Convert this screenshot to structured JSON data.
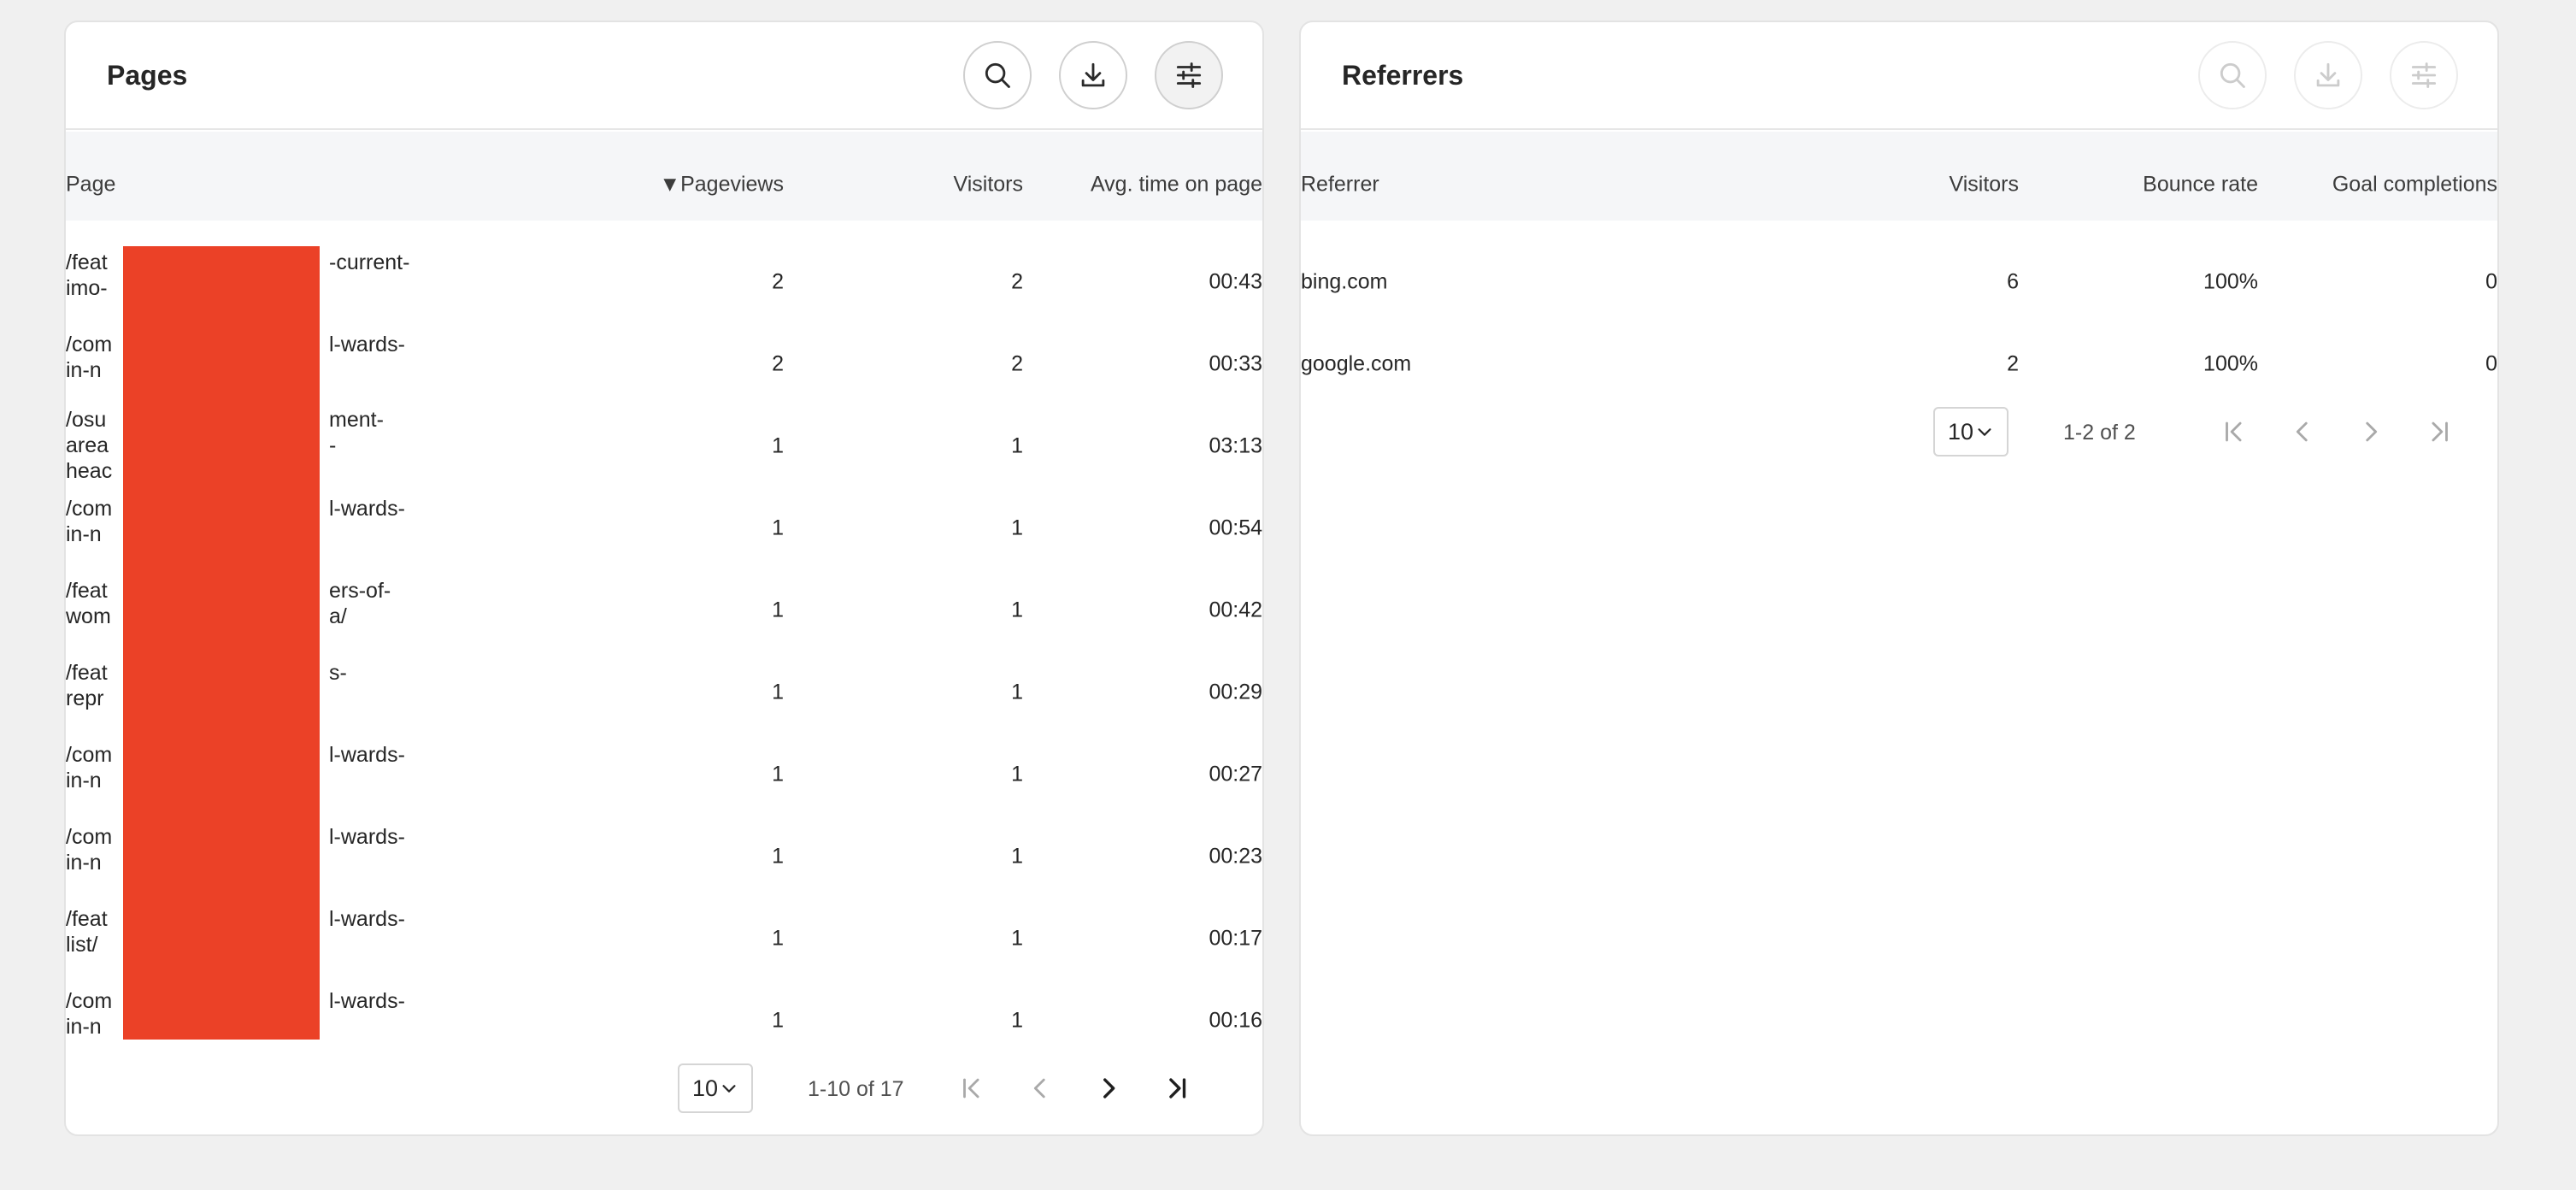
{
  "pages": {
    "title": "Pages",
    "columns": {
      "page": "Page",
      "pageviews": "▼Pageviews",
      "visitors": "Visitors",
      "avg_time": "Avg. time on page"
    },
    "rows": [
      {
        "page_start": "/feat\nimo-",
        "page_end": "-current-",
        "pageviews": "2",
        "visitors": "2",
        "avg_time": "00:43"
      },
      {
        "page_start": "/com\nin-n",
        "page_end": "l-wards-",
        "pageviews": "2",
        "visitors": "2",
        "avg_time": "00:33"
      },
      {
        "page_start": "/osu\narea\nheac",
        "page_end": "ment-\n-",
        "pageviews": "1",
        "visitors": "1",
        "avg_time": "03:13"
      },
      {
        "page_start": "/com\nin-n",
        "page_end": "l-wards-",
        "pageviews": "1",
        "visitors": "1",
        "avg_time": "00:54"
      },
      {
        "page_start": "/feat\nwom",
        "page_end": "ers-of-\na/",
        "pageviews": "1",
        "visitors": "1",
        "avg_time": "00:42"
      },
      {
        "page_start": "/feat\nrepr",
        "page_end": "s-",
        "pageviews": "1",
        "visitors": "1",
        "avg_time": "00:29"
      },
      {
        "page_start": "/com\nin-n",
        "page_end": "l-wards-",
        "pageviews": "1",
        "visitors": "1",
        "avg_time": "00:27"
      },
      {
        "page_start": "/com\nin-n",
        "page_end": "l-wards-",
        "pageviews": "1",
        "visitors": "1",
        "avg_time": "00:23"
      },
      {
        "page_start": "/feat\nlist/",
        "page_end": "l-wards-",
        "pageviews": "1",
        "visitors": "1",
        "avg_time": "00:17"
      },
      {
        "page_start": "/com\nin-n",
        "page_end": "l-wards-",
        "pageviews": "1",
        "visitors": "1",
        "avg_time": "00:16"
      }
    ],
    "pager": {
      "per_page": "10",
      "range": "1-10 of 17"
    }
  },
  "referrers": {
    "title": "Referrers",
    "columns": {
      "referrer": "Referrer",
      "visitors": "Visitors",
      "bounce_rate": "Bounce rate",
      "goal_completions": "Goal completions"
    },
    "rows": [
      {
        "referrer": "bing.com",
        "visitors": "6",
        "bounce_rate": "100%",
        "goal_completions": "0"
      },
      {
        "referrer": "google.com",
        "visitors": "2",
        "bounce_rate": "100%",
        "goal_completions": "0"
      }
    ],
    "pager": {
      "per_page": "10",
      "range": "1-2 of 2"
    }
  },
  "colors": {
    "redaction": "#eb4127",
    "header_bg": "#f5f6f8"
  },
  "icons": [
    "search-icon",
    "download-icon",
    "sliders-icon",
    "chevron-down-icon",
    "first-page-icon",
    "prev-page-icon",
    "next-page-icon",
    "last-page-icon"
  ]
}
